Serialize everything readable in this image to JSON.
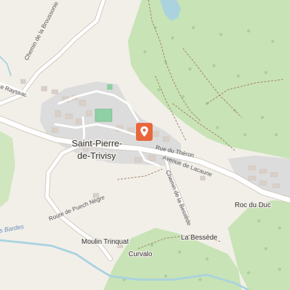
{
  "map": {
    "colors": {
      "land": "#f2efe9",
      "forest": "#c8e3b6",
      "urban": "#dcdcdc",
      "road": "#ffffff",
      "road_casing": "#cfc9c0",
      "water": "#aad3df",
      "path": "#a08060",
      "marker": "#e8663c",
      "sports": "#8fd0a4"
    },
    "town": {
      "line1": "Saint-Pierre-",
      "line2": "de-Trivisy"
    },
    "places": {
      "roc_du_duc": "Roc du Duc",
      "moulin_trinquat": "Moulin Trinquat",
      "la_bessede": "La Bessède",
      "curvalo": "Curvalo"
    },
    "roads": {
      "chemin_broussonie": "Chemin de la Broussonie",
      "de_rayssac": "e Rayssac",
      "rue_du_theron": "Rue du Théron",
      "avenue_de_lacaune": "Avenue de Lacaune",
      "chemin_bessede": "Chemin de la Bessède",
      "route_puech_negre": "Route de Puech Nègre"
    },
    "water": {
      "bardes": "s Bardes"
    },
    "marker_icon": "map-pin-icon"
  }
}
